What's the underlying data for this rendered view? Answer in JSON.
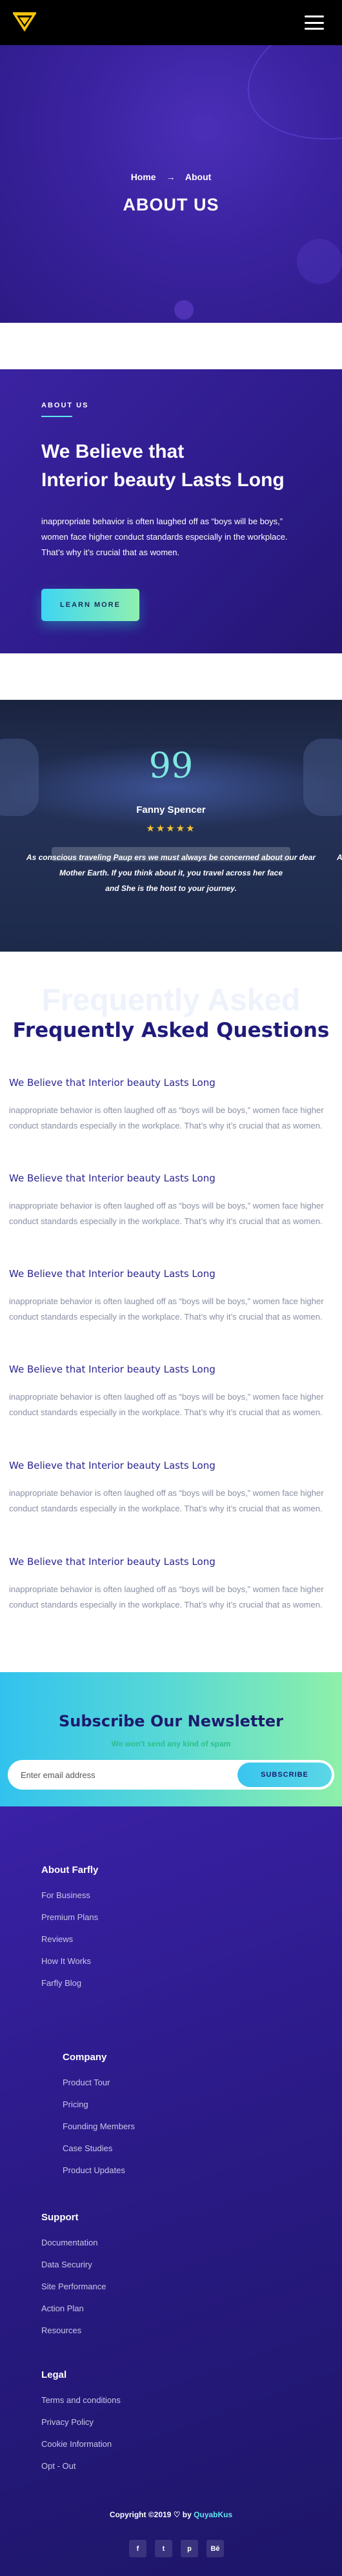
{
  "header": {
    "logo_icon": "diamond-logo-icon",
    "menu_icon": "hamburger-menu-icon"
  },
  "hero": {
    "breadcrumb": {
      "home": "Home",
      "separator": "→",
      "current": "About"
    },
    "title": "ABOUT US"
  },
  "about": {
    "kicker": "ABOUT US",
    "heading_line1": "We Believe that",
    "heading_line2": "Interior beauty Lasts Long",
    "text": "inappropriate behavior is often laughed off as “boys will be boys,” women face higher conduct standards especially in the workplace. That’s why it’s crucial that as women.",
    "button": "LEARN MORE",
    "accent_color": "#5ee6f0"
  },
  "testimonial": {
    "quote_mark": "99",
    "name": "Fanny Spencer",
    "rating": 5,
    "stars": "★★★★★",
    "line1": "As conscious traveling Paup ers we must always be concerned about our dear",
    "line1_tail": "A",
    "line2": "Mother Earth. If you think about it, you travel across her face",
    "line3": "and She is the host to your journey."
  },
  "faq": {
    "ghost_title": "Frequently Asked",
    "title": "Frequently Asked Questions",
    "items": [
      {
        "q": "We Believe that Interior beauty Lasts Long",
        "a": "inappropriate behavior is often laughed off as “boys will be boys,” women face higher conduct standards especially in the workplace. That’s why it’s crucial that as women."
      },
      {
        "q": "We Believe that Interior beauty Lasts Long",
        "a": "inappropriate behavior is often laughed off as “boys will be boys,” women face higher conduct standards especially in the workplace. That’s why it’s crucial that as women."
      },
      {
        "q": "We Believe that Interior beauty Lasts Long",
        "a": "inappropriate behavior is often laughed off as “boys will be boys,” women face higher conduct standards especially in the workplace. That’s why it’s crucial that as women."
      },
      {
        "q": "We Believe that Interior beauty Lasts Long",
        "a": "inappropriate behavior is often laughed off as “boys will be boys,” women face higher conduct standards especially in the workplace. That’s why it’s crucial that as women."
      },
      {
        "q": "We Believe that Interior beauty Lasts Long",
        "a": "inappropriate behavior is often laughed off as “boys will be boys,” women face higher conduct standards especially in the workplace. That’s why it’s crucial that as women."
      },
      {
        "q": "We Believe that Interior beauty Lasts Long",
        "a": "inappropriate behavior is often laughed off as “boys will be boys,” women face higher conduct standards especially in the workplace. That’s why it’s crucial that as women."
      }
    ]
  },
  "newsletter": {
    "title": "Subscribe Our Newsletter",
    "subtitle": "We won't send any kind of spam",
    "placeholder": "Enter email address",
    "button": "SUBSCRIBE"
  },
  "footer": {
    "columns": [
      {
        "title": "About Farfly",
        "links": [
          "For Business",
          "Premium Plans",
          "Reviews",
          "How It Works",
          "Farfly Blog"
        ]
      },
      {
        "title": "Company",
        "links": [
          "Product Tour",
          "Pricing",
          "Founding Members",
          "Case Studies",
          "Product Updates"
        ]
      },
      {
        "title": "Support",
        "links": [
          "Documentation",
          "Data Securiry",
          "Site Performance",
          "Action Plan",
          "Resources"
        ]
      },
      {
        "title": "Legal",
        "links": [
          "Terms and conditions",
          "Privacy Policy",
          "Cookie Information",
          "Opt - Out"
        ]
      }
    ],
    "copyright_prefix": "Copyright ©2019",
    "heart": "♡",
    "by": "by",
    "brand": "QuyabKus",
    "socials": [
      {
        "icon": "facebook-icon",
        "glyph": "f"
      },
      {
        "icon": "twitter-icon",
        "glyph": "t"
      },
      {
        "icon": "pinterest-icon",
        "glyph": "p"
      },
      {
        "icon": "behance-icon",
        "glyph": "Bē"
      }
    ]
  }
}
